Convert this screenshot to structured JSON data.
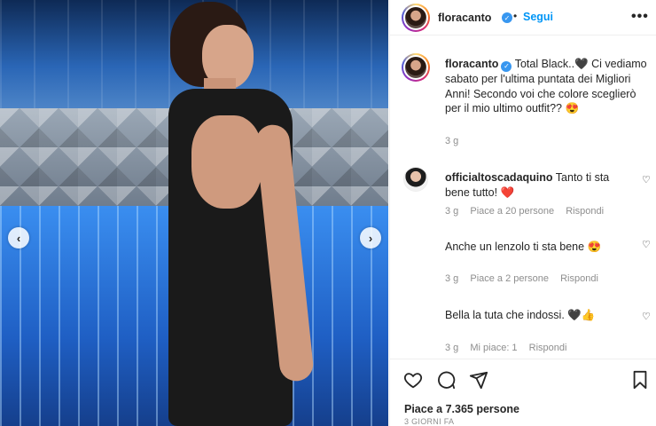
{
  "media": {
    "prev_icon": "chevron-left-icon",
    "next_icon": "chevron-right-icon",
    "prev_glyph": "‹",
    "next_glyph": "›"
  },
  "header": {
    "username": "floracanto",
    "verified_glyph": "✓",
    "separator": "•",
    "follow_label": "Segui",
    "more_glyph": "•••"
  },
  "caption": {
    "username": "floracanto",
    "text": "Total Black..🖤 Ci vediamo sabato per l'ultima puntata dei Migliori Anni! Secondo voi che colore sceglierò per il mio ultimo outfit?? 😍",
    "time": "3 g"
  },
  "comments": [
    {
      "username": "officialtoscadaquino",
      "text": "Tanto ti sta bene tutto!",
      "emoji": "❤️",
      "time": "3 g",
      "likes": "Piace a 20 persone",
      "reply": "Rispondi"
    },
    {
      "username": "",
      "text": "Anche un lenzolo ti sta bene",
      "emoji": "😍",
      "time": "3 g",
      "likes": "Piace a 2 persone",
      "reply": "Rispondi"
    },
    {
      "username": "",
      "text": "Bella la tuta che indossi.",
      "emoji": "🖤👍",
      "time": "3 g",
      "likes": "Mi piace: 1",
      "reply": "Rispondi"
    }
  ],
  "footer": {
    "likes_text": "Piace a 7.365 persone",
    "date_text": "3 GIORNI FA"
  },
  "colors": {
    "accent": "#0095f6",
    "verified": "#3897f0",
    "heart": "#ed4956",
    "muted": "#8e8e8e"
  }
}
